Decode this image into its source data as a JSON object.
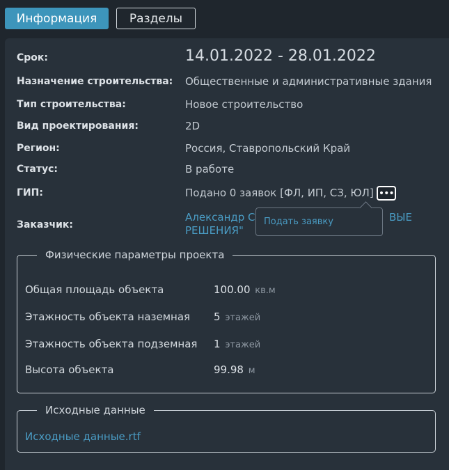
{
  "tabs": [
    {
      "label": "Информация",
      "active": true
    },
    {
      "label": "Разделы",
      "active": false
    }
  ],
  "info": {
    "term": {
      "label": "Срок:",
      "value": "14.01.2022 - 28.01.2022"
    },
    "purpose": {
      "label": "Назначение строительства:",
      "value": "Общественные и административные здания"
    },
    "build_type": {
      "label": "Тип строительства:",
      "value": "Новое строительство"
    },
    "design_type": {
      "label": "Вид проектирования:",
      "value": "2D"
    },
    "region": {
      "label": "Регион:",
      "value": "Россия, Ставропольский Край"
    },
    "status": {
      "label": "Статус:",
      "value": "В работе"
    },
    "gip": {
      "label": "ГИП:",
      "value": "Подано 0 заявок [ФЛ, ИП, СЗ, ЮЛ]",
      "more_icon": "•••"
    },
    "customer": {
      "label": "Заказчик:",
      "line1_start": "Александр Ст",
      "line1_end": "ВЫЕ",
      "line2": "РЕШЕНИЯ\""
    }
  },
  "popup": {
    "item": "Подать заявку"
  },
  "params": {
    "legend": "Физические параметры проекта",
    "rows": [
      {
        "label": "Общая площадь объекта",
        "value": "100.00",
        "unit": "кв.м"
      },
      {
        "label": "Этажность объекта наземная",
        "value": "5",
        "unit": "этажей"
      },
      {
        "label": "Этажность объекта подземная",
        "value": "1",
        "unit": "этажей"
      },
      {
        "label": "Высота объекта",
        "value": "99.98",
        "unit": "м"
      }
    ]
  },
  "source": {
    "legend": "Исходные данные",
    "file": "Исходные данные.rtf"
  },
  "colors": {
    "accent": "#3d95bb",
    "link": "#4a9cc4",
    "background": "#1f262d",
    "panel": "#28313a"
  }
}
